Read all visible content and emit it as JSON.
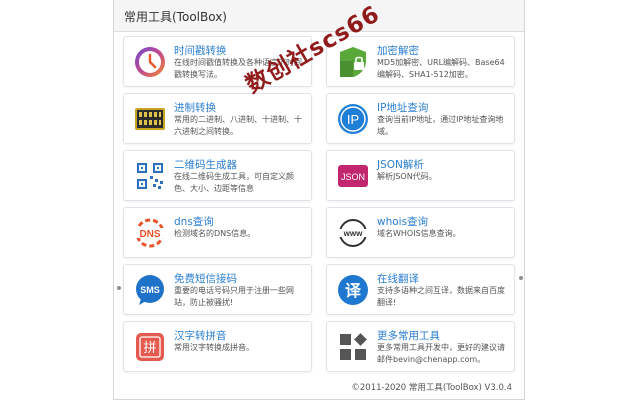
{
  "header": {
    "title": "常用工具(ToolBox)"
  },
  "tools": [
    {
      "name": "时间戳转换",
      "desc": "在线时间戳值转换及各种语言下时间戳转换写法。",
      "icon": "clock-icon"
    },
    {
      "name": "加密解密",
      "desc": "MD5加解密、URL编解码、Base64编解码、SHA1-512加密。",
      "icon": "shield-lock-icon"
    },
    {
      "name": "进制转换",
      "desc": "常用的二进制、八进制、十进制、十六进制之间转换。",
      "icon": "binary-board-icon"
    },
    {
      "name": "IP地址查询",
      "desc": "查询当前IP地址，通过IP地址查询地域。",
      "icon": "ip-icon"
    },
    {
      "name": "二维码生成器",
      "desc": "在线二维码生成工具，可自定义颜色、大小、边距等信息",
      "icon": "qrcode-icon"
    },
    {
      "name": "JSON解析",
      "desc": "解析JSON代码。",
      "icon": "json-icon"
    },
    {
      "name": "dns查询",
      "desc": "检测域名的DNS信息。",
      "icon": "dns-icon"
    },
    {
      "name": "whois查询",
      "desc": "域名WHOIS信息查询。",
      "icon": "www-icon"
    },
    {
      "name": "免费短信接码",
      "desc": "重要的电话号码只用于注册一些网站，防止被骚扰!",
      "icon": "sms-icon"
    },
    {
      "name": "在线翻译",
      "desc": "支持多语种之间互译，数据来自百度翻译!",
      "icon": "translate-icon"
    },
    {
      "name": "汉字转拼音",
      "desc": "常用汉字转换成拼音。",
      "icon": "pinyin-icon"
    },
    {
      "name": "更多常用工具",
      "desc": "更多常用工具开发中，更好的建议请邮件bevin@chenapp.com。",
      "icon": "more-tools-icon"
    }
  ],
  "footer": {
    "copyright": "©2011-2020 常用工具(ToolBox) V3.0.4"
  },
  "watermark": {
    "text": "数创社scs66"
  },
  "colors": {
    "link": "#2c7fd1",
    "shield_green": "#5aa83a",
    "binary_gold": "#c8a324",
    "ip_blue": "#1f7ed6",
    "qr_blue": "#2d6ebf",
    "json_magenta": "#c2266f",
    "dns_orange": "#e8542a",
    "sms_blue": "#1f72c9",
    "translate_blue": "#1e78d0",
    "pinyin_red": "#e55a4e",
    "watermark": "#8b1010"
  }
}
